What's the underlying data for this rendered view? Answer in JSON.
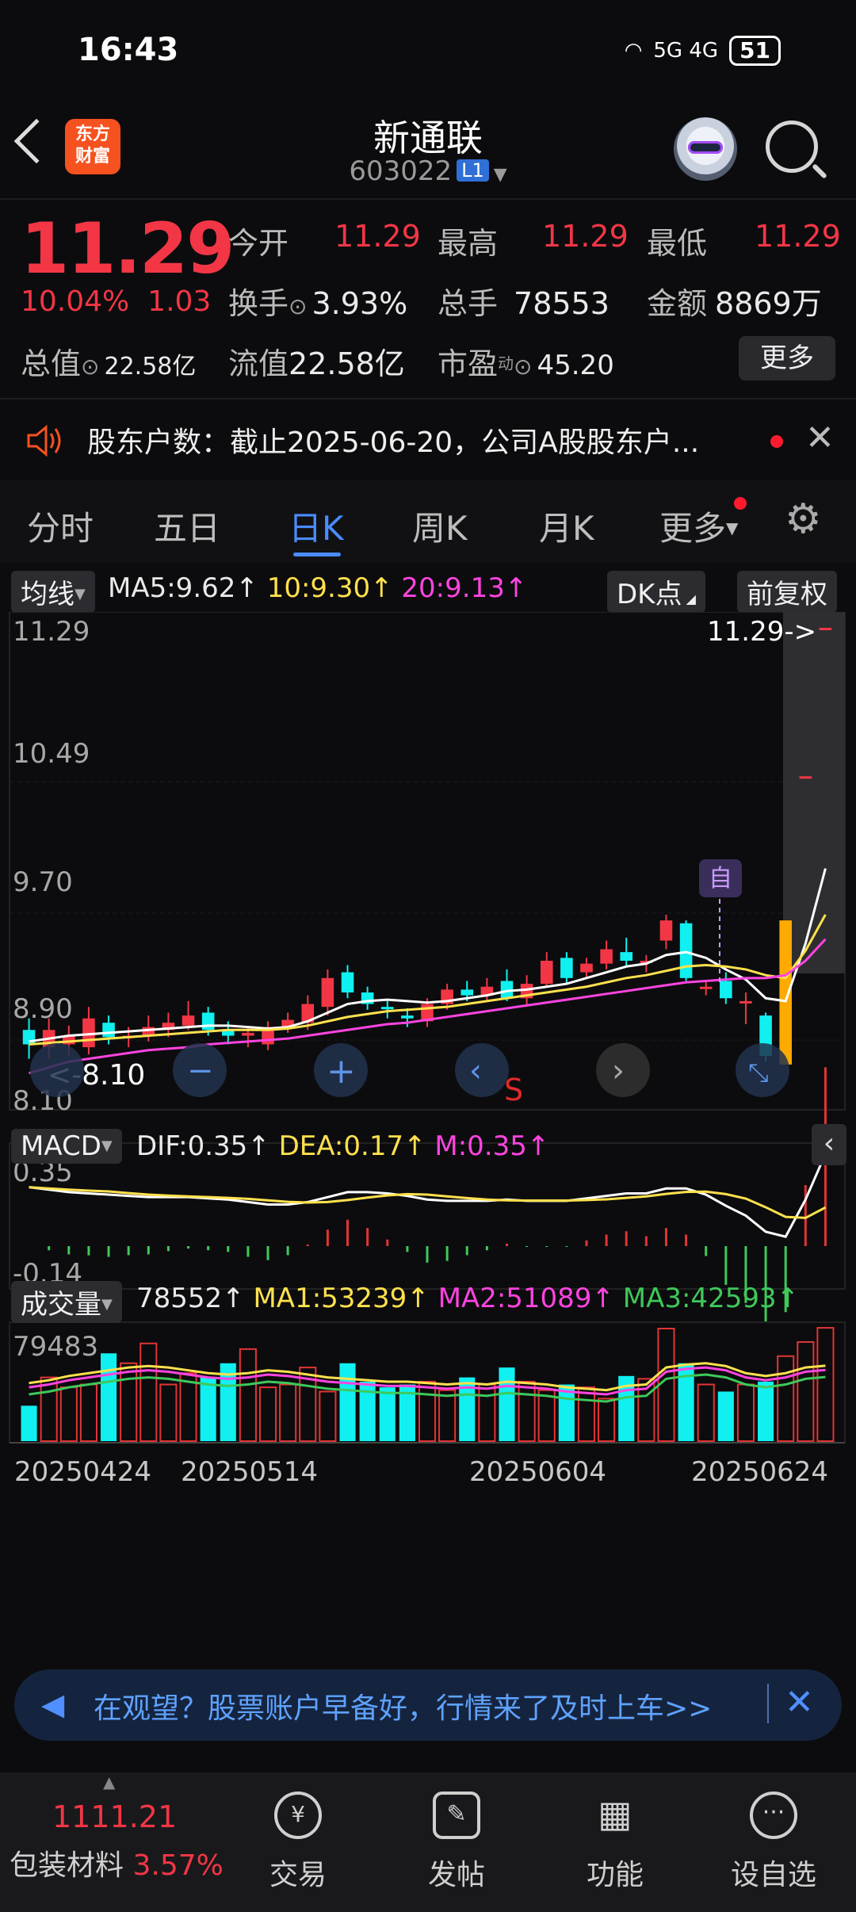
{
  "status_bar": {
    "time": "16:43",
    "network": "5G 4G",
    "battery": "51"
  },
  "header": {
    "logo_line1": "东方",
    "logo_line2": "财富",
    "stock_name": "新通联",
    "stock_code": "603022",
    "level_badge": "L1"
  },
  "quote": {
    "price": "11.29",
    "change_pct": "10.04%",
    "change_abs": "1.03",
    "open_label": "今开",
    "open": "11.29",
    "high_label": "最高",
    "high": "11.29",
    "low_label": "最低",
    "low": "11.29",
    "turnover_label": "换手",
    "turnover": "3.93%",
    "volume_label": "总手",
    "volume": "78553",
    "amount_label": "金额",
    "amount": "8869万",
    "total_cap_label": "总值",
    "total_cap": "22.58亿",
    "float_cap_label": "流值",
    "float_cap": "22.58亿",
    "pe_label": "市盈",
    "pe_sup": "动",
    "pe": "45.20",
    "more_button": "更多"
  },
  "notice": {
    "text": "股东户数：截止2025-06-20，公司A股股东户..."
  },
  "tabs": [
    {
      "label": "分时"
    },
    {
      "label": "五日"
    },
    {
      "label": "日K"
    },
    {
      "label": "周K"
    },
    {
      "label": "月K"
    },
    {
      "label": "更多"
    }
  ],
  "chart_toolbar": {
    "indicator": "均线",
    "ma5": "MA5:9.62↑",
    "ma10": "10:9.30↑",
    "ma20": "20:9.13↑",
    "dk": "DK点",
    "adjust": "前复权"
  },
  "price_axis": {
    "ticks": [
      "11.29",
      "10.49",
      "9.70",
      "8.90",
      "8.10"
    ],
    "max_marker": "11.29->",
    "min_marker": "<-8.10",
    "tag_self": "自",
    "tag_s": "S"
  },
  "macd_bar": {
    "label": "MACD",
    "dif": "DIF:0.35↑",
    "dea": "DEA:0.17↑",
    "m": "M:0.35↑",
    "ticks": [
      "0.35",
      "-0.14"
    ]
  },
  "volume_bar": {
    "label": "成交量",
    "vol": "78552↑",
    "ma1": "MA1:53239↑",
    "ma2": "MA2:51089↑",
    "ma3": "MA3:42593↑",
    "ticks": [
      "79483"
    ]
  },
  "date_ticks": [
    "20250424",
    "20250514",
    "20250604",
    "20250624"
  ],
  "banner": {
    "text": "在观望？股票账户早备好，行情来了及时上车>>"
  },
  "bottom_nav": {
    "index_value": "1111.21",
    "index_name": "包装材料",
    "index_change": "3.57%",
    "items": [
      {
        "label": "交易"
      },
      {
        "label": "发帖"
      },
      {
        "label": "功能"
      },
      {
        "label": "设自选"
      }
    ]
  },
  "colors": {
    "up": "#f23645",
    "down": "#10f0f0",
    "accent": "#4a8cff",
    "ma5": "#ffffff",
    "ma10": "#ffe14d",
    "ma20": "#ff44e0"
  },
  "chart_data": {
    "type": "candlestick",
    "ylim": [
      8.1,
      11.29
    ],
    "candles": [
      {
        "o": 8.5,
        "c": 8.4,
        "h": 8.58,
        "l": 8.3
      },
      {
        "o": 8.38,
        "c": 8.5,
        "h": 8.58,
        "l": 8.3
      },
      {
        "o": 8.4,
        "c": 8.46,
        "h": 8.53,
        "l": 8.32
      },
      {
        "o": 8.38,
        "c": 8.58,
        "h": 8.66,
        "l": 8.33
      },
      {
        "o": 8.55,
        "c": 8.45,
        "h": 8.6,
        "l": 8.4
      },
      {
        "o": 8.45,
        "c": 8.46,
        "h": 8.52,
        "l": 8.38
      },
      {
        "o": 8.46,
        "c": 8.52,
        "h": 8.6,
        "l": 8.42
      },
      {
        "o": 8.5,
        "c": 8.55,
        "h": 8.62,
        "l": 8.45
      },
      {
        "o": 8.53,
        "c": 8.6,
        "h": 8.7,
        "l": 8.5
      },
      {
        "o": 8.62,
        "c": 8.5,
        "h": 8.66,
        "l": 8.46
      },
      {
        "o": 8.5,
        "c": 8.46,
        "h": 8.56,
        "l": 8.4
      },
      {
        "o": 8.46,
        "c": 8.48,
        "h": 8.52,
        "l": 8.38
      },
      {
        "o": 8.4,
        "c": 8.52,
        "h": 8.56,
        "l": 8.36
      },
      {
        "o": 8.52,
        "c": 8.57,
        "h": 8.62,
        "l": 8.48
      },
      {
        "o": 8.55,
        "c": 8.68,
        "h": 8.74,
        "l": 8.5
      },
      {
        "o": 8.66,
        "c": 8.86,
        "h": 8.92,
        "l": 8.6
      },
      {
        "o": 8.9,
        "c": 8.76,
        "h": 8.95,
        "l": 8.72
      },
      {
        "o": 8.76,
        "c": 8.68,
        "h": 8.8,
        "l": 8.64
      },
      {
        "o": 8.66,
        "c": 8.65,
        "h": 8.7,
        "l": 8.58
      },
      {
        "o": 8.6,
        "c": 8.58,
        "h": 8.65,
        "l": 8.52
      },
      {
        "o": 8.56,
        "c": 8.68,
        "h": 8.72,
        "l": 8.52
      },
      {
        "o": 8.68,
        "c": 8.78,
        "h": 8.82,
        "l": 8.64
      },
      {
        "o": 8.78,
        "c": 8.74,
        "h": 8.84,
        "l": 8.7
      },
      {
        "o": 8.74,
        "c": 8.8,
        "h": 8.86,
        "l": 8.7
      },
      {
        "o": 8.84,
        "c": 8.72,
        "h": 8.92,
        "l": 8.7
      },
      {
        "o": 8.72,
        "c": 8.82,
        "h": 8.88,
        "l": 8.66
      },
      {
        "o": 8.82,
        "c": 8.98,
        "h": 9.04,
        "l": 8.8
      },
      {
        "o": 9.0,
        "c": 8.86,
        "h": 9.04,
        "l": 8.82
      },
      {
        "o": 8.9,
        "c": 8.96,
        "h": 9.0,
        "l": 8.86
      },
      {
        "o": 8.96,
        "c": 9.06,
        "h": 9.12,
        "l": 8.92
      },
      {
        "o": 9.04,
        "c": 8.98,
        "h": 9.14,
        "l": 8.94
      },
      {
        "o": 8.98,
        "c": 8.98,
        "h": 9.02,
        "l": 8.9
      },
      {
        "o": 9.12,
        "c": 9.26,
        "h": 9.3,
        "l": 9.06
      },
      {
        "o": 9.24,
        "c": 8.86,
        "h": 9.26,
        "l": 8.84
      },
      {
        "o": 8.8,
        "c": 8.8,
        "h": 8.84,
        "l": 8.74
      },
      {
        "o": 8.84,
        "c": 8.72,
        "h": 8.9,
        "l": 8.68
      },
      {
        "o": 8.7,
        "c": 8.7,
        "h": 8.76,
        "l": 8.54
      },
      {
        "o": 8.6,
        "c": 8.32,
        "h": 8.62,
        "l": 8.28
      },
      {
        "o": 8.26,
        "c": 9.26,
        "h": 9.26,
        "l": 8.26
      },
      {
        "o": 10.26,
        "c": 10.26,
        "h": 10.26,
        "l": 10.26
      },
      {
        "o": 11.29,
        "c": 11.29,
        "h": 11.29,
        "l": 11.29
      }
    ],
    "ma5": [
      8.42,
      8.44,
      8.46,
      8.47,
      8.48,
      8.49,
      8.5,
      8.51,
      8.52,
      8.53,
      8.53,
      8.52,
      8.51,
      8.52,
      8.56,
      8.62,
      8.68,
      8.7,
      8.71,
      8.7,
      8.69,
      8.7,
      8.72,
      8.74,
      8.77,
      8.78,
      8.8,
      8.82,
      8.86,
      8.9,
      8.94,
      8.96,
      9.02,
      9.04,
      9.0,
      8.92,
      8.85,
      8.72,
      8.7,
      9.1,
      9.62
    ],
    "ma10": [
      8.4,
      8.41,
      8.42,
      8.43,
      8.44,
      8.45,
      8.46,
      8.47,
      8.48,
      8.49,
      8.5,
      8.5,
      8.5,
      8.51,
      8.53,
      8.56,
      8.59,
      8.61,
      8.63,
      8.64,
      8.65,
      8.66,
      8.68,
      8.7,
      8.72,
      8.74,
      8.76,
      8.78,
      8.8,
      8.83,
      8.86,
      8.88,
      8.91,
      8.94,
      8.95,
      8.94,
      8.92,
      8.88,
      8.86,
      9.05,
      9.3
    ],
    "ma20": [
      8.2,
      8.24,
      8.28,
      8.3,
      8.32,
      8.34,
      8.36,
      8.37,
      8.38,
      8.4,
      8.41,
      8.42,
      8.43,
      8.44,
      8.46,
      8.48,
      8.5,
      8.52,
      8.54,
      8.55,
      8.57,
      8.59,
      8.61,
      8.63,
      8.65,
      8.67,
      8.69,
      8.71,
      8.73,
      8.75,
      8.77,
      8.79,
      8.81,
      8.83,
      8.84,
      8.85,
      8.86,
      8.86,
      8.88,
      8.98,
      9.13
    ],
    "volume": {
      "ylim": [
        0,
        79483
      ],
      "values": [
        25000,
        45000,
        38000,
        40000,
        62000,
        55000,
        69000,
        40000,
        48000,
        45000,
        55000,
        65000,
        38000,
        40000,
        52000,
        35000,
        55000,
        42000,
        38000,
        40000,
        42000,
        36000,
        45000,
        40000,
        52000,
        42000,
        36000,
        40000,
        38000,
        30000,
        46000,
        44000,
        79483,
        55000,
        40000,
        35000,
        40000,
        42000,
        60000,
        70000,
        80000
      ],
      "ma1": [
        41000,
        43000,
        46000,
        48000,
        50000,
        52000,
        53000,
        52000,
        50000,
        48000,
        47000,
        48000,
        50000,
        49000,
        47000,
        45000,
        44000,
        43000,
        42000,
        42000,
        41000,
        40000,
        41000,
        40000,
        42000,
        41000,
        40000,
        38000,
        37000,
        36000,
        39000,
        40000,
        52000,
        54000,
        55000,
        53000,
        48000,
        46000,
        48000,
        52000,
        53239
      ]
    }
  }
}
